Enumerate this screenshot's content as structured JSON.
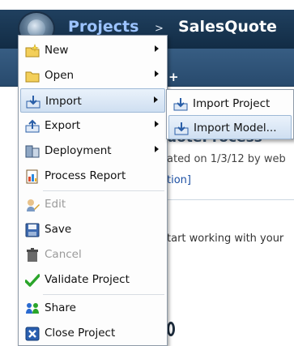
{
  "header": {
    "breadcrumb_root": "Projects",
    "breadcrumb_separator": ">",
    "current_project": "SalesQuote"
  },
  "tabs": {
    "add_tab_label": "+"
  },
  "project": {
    "title_fragment": "uoteProcess",
    "created_fragment": "ated on 1/3/12 by web",
    "edit_description_fragment": "tion]",
    "hint_fragment": "tart working with your"
  },
  "main_menu": {
    "items": [
      {
        "label": "New",
        "icon": "new-folder-icon",
        "has_submenu": true
      },
      {
        "label": "Open",
        "icon": "folder-icon",
        "has_submenu": true
      },
      {
        "label": "Import",
        "icon": "import-icon",
        "has_submenu": true,
        "highlighted": true
      },
      {
        "label": "Export",
        "icon": "export-icon",
        "has_submenu": true
      },
      {
        "label": "Deployment",
        "icon": "deployment-icon",
        "has_submenu": true
      },
      {
        "label": "Process Report",
        "icon": "report-icon",
        "has_submenu": false
      },
      {
        "label": "Edit",
        "icon": "edit-icon",
        "disabled": true
      },
      {
        "label": "Save",
        "icon": "save-icon"
      },
      {
        "label": "Cancel",
        "icon": "cancel-icon",
        "disabled": true
      },
      {
        "label": "Validate Project",
        "icon": "checkmark-icon"
      },
      {
        "label": "Share",
        "icon": "share-icon"
      },
      {
        "label": "Close Project",
        "icon": "close-icon"
      }
    ]
  },
  "import_submenu": {
    "items": [
      {
        "label": "Import Project",
        "icon": "import-icon"
      },
      {
        "label": "Import Model...",
        "icon": "import-icon",
        "highlighted": true
      }
    ]
  },
  "colors": {
    "header_bg": "#1b3652",
    "breadcrumb_link": "#9cc3ff",
    "menu_highlight": "#cfdff1",
    "disabled_text": "#9a9a9a"
  }
}
